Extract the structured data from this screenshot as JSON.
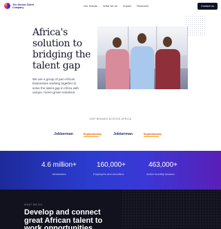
{
  "header": {
    "logo_text": "The African Talent Company",
    "nav": [
      "Our brands",
      "What we do",
      "Impact",
      "Research"
    ],
    "contact_label": "Contact Us"
  },
  "hero": {
    "title": "Africa's solution to bridging the talent gap",
    "body": "We are a group of pan-African businesses working together to solve the talent gap in Africa with unique, home-grown solutions."
  },
  "brands": {
    "label": "OUR BRANDS ACROSS AFRICA",
    "items": [
      "Jobberman",
      "BrighterMonday",
      "Jobberman",
      "BrighterMonday"
    ]
  },
  "stats": [
    {
      "value": "4.6 million+",
      "label": "Jobseekers"
    },
    {
      "value": "160,000+",
      "label": "Employers and recruiters"
    },
    {
      "value": "463,000+",
      "label": "Active monthly session"
    }
  ],
  "what_we_do": {
    "label": "WHAT WE DO",
    "title": "Develop and connect great African talent to work opportunities"
  },
  "colors": {
    "accent": "#2b3ccf",
    "dark": "#12121e",
    "brand_purple": "#5a1fb8"
  }
}
